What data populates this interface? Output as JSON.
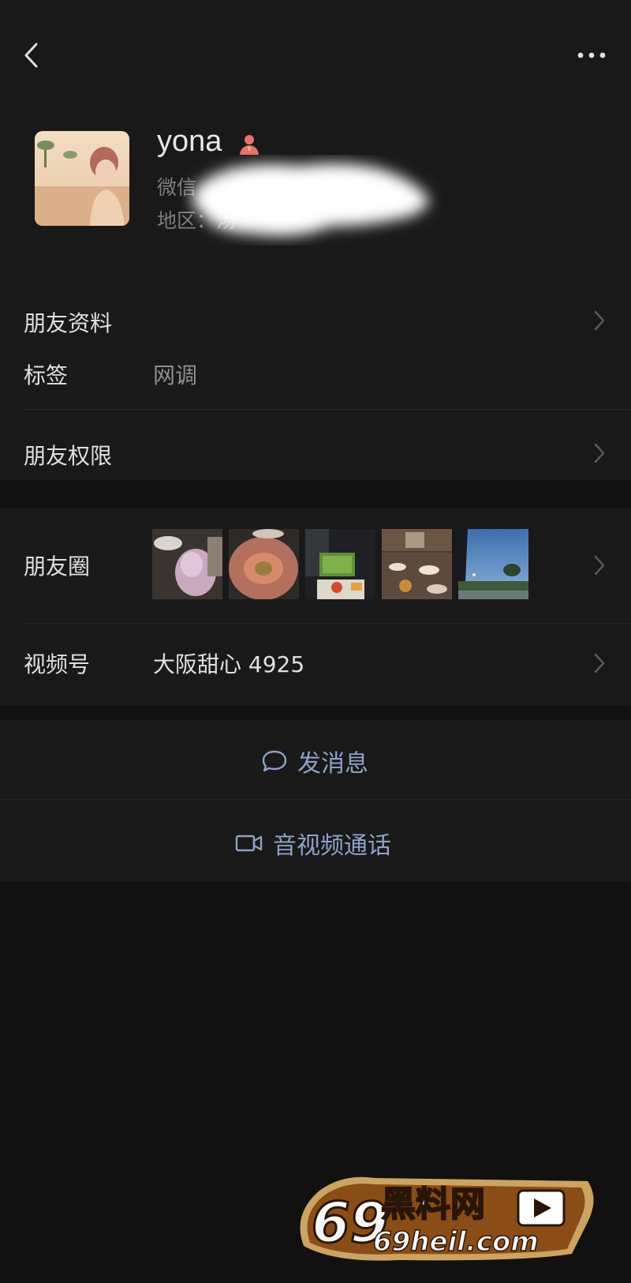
{
  "profile": {
    "nickname": "yona",
    "id_label": "微信",
    "region_label": "地区：",
    "region_value": "汤"
  },
  "rows": {
    "friend_profile": "朋友资料",
    "tag_label": "标签",
    "tag_value": "网调",
    "permissions": "朋友权限",
    "moments": "朋友圈",
    "channels_label": "视频号",
    "channels_value": "大阪甜心 4925"
  },
  "actions": {
    "message": "发消息",
    "av_call": "音视频通话"
  },
  "watermark": {
    "brand": "69黑料网",
    "domain": "69heil.com"
  },
  "colors": {
    "background": "#111111",
    "panel": "#191919",
    "link": "#8ea1c8",
    "gender_female": "#e8736d"
  },
  "icons": {
    "back": "chevron-left-icon",
    "more": "more-dots-icon",
    "gender": "female-icon",
    "message": "chat-bubble-icon",
    "call": "video-camera-icon"
  }
}
